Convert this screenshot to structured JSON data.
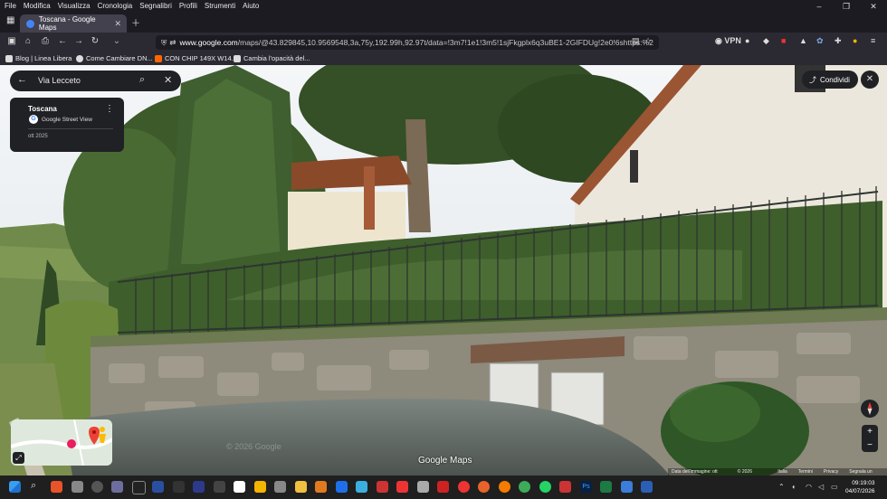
{
  "menu": [
    "File",
    "Modifica",
    "Visualizza",
    "Cronologia",
    "Segnalibri",
    "Profili",
    "Strumenti",
    "Aiuto"
  ],
  "tab": {
    "title": "Toscana - Google Maps"
  },
  "url": {
    "host": "www.google.com",
    "rest": "/maps/@43.829845,10.9569548,3a,75y,192.99h,92.97t/data=!3m7!1e1!3m5!1sjFkgplx6q3uBE1-2GIFDUg!2e0!6shttps:%2"
  },
  "vpn_label": "VPN",
  "bookmarks": [
    "Blog | Linea Libera",
    "Come Cambiare DN...",
    "CON CHIP 149X W14...",
    "Cambia l'opacità del..."
  ],
  "search": {
    "value": "Via Lecceto"
  },
  "place": {
    "title": "Toscana",
    "source": "Google Street View",
    "date": "ott 2025"
  },
  "share_label": "Condividi",
  "watermark": "© 2026 Google",
  "logo": "Google Maps",
  "attribution": [
    "Data dell'immagine: ott 2025",
    "© 2026 Google",
    "Italia",
    "Termini",
    "Privacy",
    "Segnala un problema"
  ],
  "clock": {
    "time": "09:19:03",
    "date": "04/07/2026"
  },
  "colors": {
    "accent": "#4285f4",
    "chrome": "#1c1b22",
    "toolbar": "#2b2a33"
  }
}
